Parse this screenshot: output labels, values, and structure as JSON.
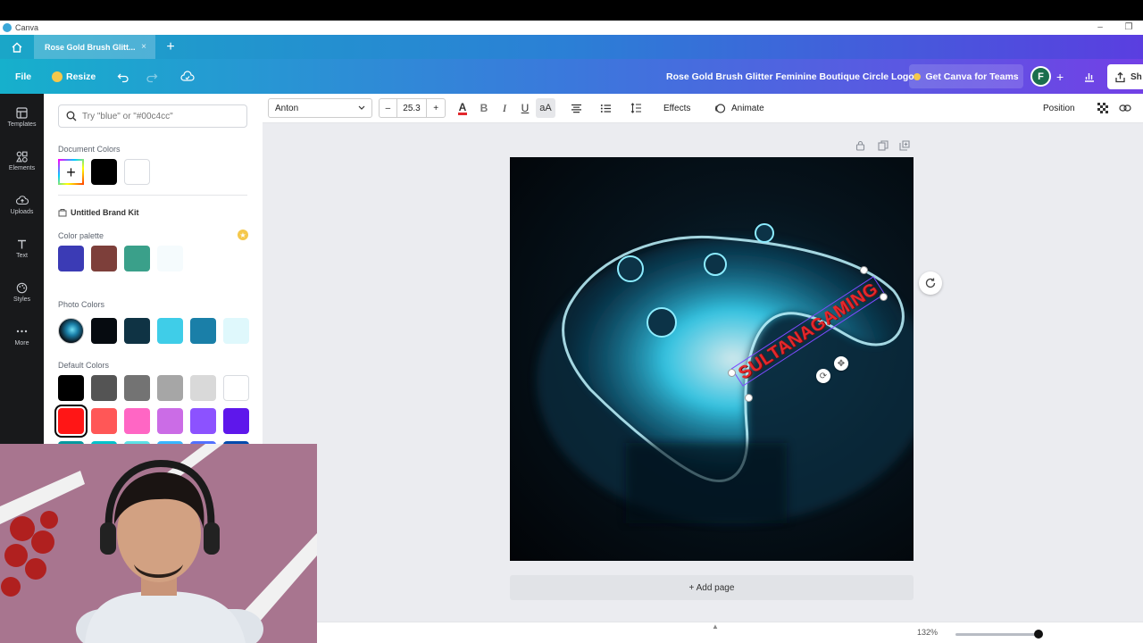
{
  "window": {
    "app_name": "Canva",
    "controls": [
      "–",
      "❐"
    ]
  },
  "tabs": {
    "active_tab": "Rose Gold Brush Glitt...",
    "close": "×",
    "add": "+"
  },
  "header": {
    "file": "File",
    "resize": "Resize",
    "doc_title": "Rose Gold Brush Glitter Feminine Boutique Circle Logo",
    "teams_button": "Get Canva for Teams",
    "avatar_letter": "F",
    "add": "+",
    "share": "Sh"
  },
  "rail": {
    "items": [
      {
        "label": "Templates",
        "icon": "templates-icon"
      },
      {
        "label": "Elements",
        "icon": "elements-icon"
      },
      {
        "label": "Uploads",
        "icon": "uploads-icon"
      },
      {
        "label": "Text",
        "icon": "text-icon"
      },
      {
        "label": "Styles",
        "icon": "styles-icon"
      },
      {
        "label": "More",
        "icon": "more-icon"
      }
    ]
  },
  "panel": {
    "search_placeholder": "Try \"blue\" or \"#00c4cc\"",
    "document_colors_label": "Document Colors",
    "document_colors": [
      "#000000",
      "#ffffff"
    ],
    "brand_kit_label": "Untitled Brand Kit",
    "color_palette_label": "Color palette",
    "palette_colors": [
      "#3b3bb5",
      "#7d3f3a",
      "#3aa08a",
      "#f5fbfd"
    ],
    "photo_colors_label": "Photo Colors",
    "photo_colors": [
      "#060b10",
      "#0f3344",
      "#3fcde8",
      "#1a7fa8",
      "#dff8fc"
    ],
    "default_colors_label": "Default Colors",
    "default_row1": [
      "#000000",
      "#545454",
      "#737373",
      "#a6a6a6",
      "#d9d9d9",
      "#ffffff"
    ],
    "default_row2": [
      "#ff1616",
      "#ff5757",
      "#ff66c4",
      "#cb6ce6",
      "#8c52ff",
      "#5e17eb"
    ],
    "default_row3": [
      "#03989e",
      "#00c2cb",
      "#5ce1e6",
      "#38b6ff",
      "#5271ff",
      "#004aad"
    ]
  },
  "toolbar": {
    "font": "Anton",
    "minus": "–",
    "font_size": "25.3",
    "plus": "+",
    "text_color_glyph": "A",
    "bold": "B",
    "italic": "I",
    "underline": "U",
    "case": "aA",
    "effects": "Effects",
    "animate": "Animate",
    "position": "Position"
  },
  "canvas": {
    "text_element": "SULTANAGAMING",
    "add_page": "+ Add page",
    "zoom": "132%",
    "text_color": "#e3282c"
  }
}
